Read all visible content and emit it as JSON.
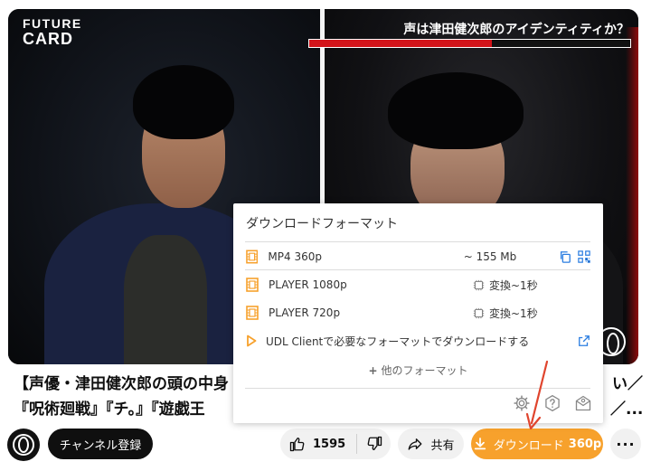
{
  "video": {
    "brand_line1": "FUTURE",
    "brand_line2": "CARD",
    "caption": "声は津田健次郎のアイデンティティか？",
    "caption_progress": 0.57
  },
  "title": {
    "line1": "【声優・津田健次郎の頭の中身",
    "line1_tail": "い／",
    "line2": "『呪術廻戦』『チ。』『遊戯王",
    "line2_tail": "／..."
  },
  "actions": {
    "subscribe_label": "チャンネル登録",
    "like_count": "1595",
    "share_label": "共有",
    "download_label": "ダウンロード",
    "download_quality": "360p",
    "more_label": "···"
  },
  "popup": {
    "title": "ダウンロードフォーマット",
    "formats": [
      {
        "name": "MP4 360p",
        "size": "~ 155 Mb"
      },
      {
        "name": "PLAYER 1080p",
        "size": "変換~1秒"
      },
      {
        "name": "PLAYER 720p",
        "size": "変換~1秒"
      }
    ],
    "udl_text": "UDL Clientで必要なフォーマットでダウンロードする",
    "more_formats": "他のフォーマット"
  },
  "colors": {
    "download_orange": "#f7a12c",
    "caption_red": "#d3141a",
    "arrow_red": "#e0452e"
  }
}
